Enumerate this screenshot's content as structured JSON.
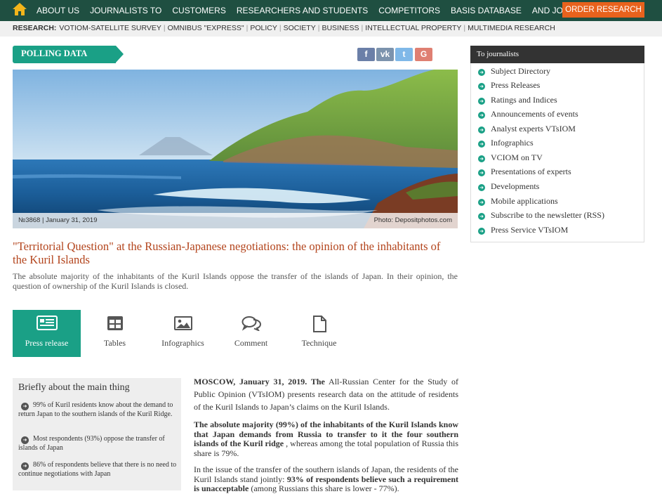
{
  "nav": {
    "items": [
      "ABOUT US",
      "JOURNALISTS TO",
      "CUSTOMERS",
      "RESEARCHERS AND STUDENTS",
      "COMPETITORS",
      "BASIS DATABASE",
      "AND JOURNAL"
    ],
    "order_button": "ORDER RESEARCH",
    "colors": {
      "bar": "#1f4f41",
      "order": "#e8621d"
    }
  },
  "research": {
    "label": "RESEARCH:",
    "items": [
      "VOTIOM-SATELLITE SURVEY",
      "OMNIBUS \"EXPRESS\"",
      "POLICY",
      "SOCIETY",
      "BUSINESS",
      "INTELLECTUAL PROPERTY",
      "MULTIMEDIA RESEARCH"
    ]
  },
  "polling_label": "POLLING DATA",
  "share": {
    "fb": "f",
    "vk": "vk",
    "tw": "t",
    "gp": "G"
  },
  "hero": {
    "id_date": "№3868 | January 31, 2019",
    "photo_credit": "Photo: Depositphotos.com"
  },
  "article": {
    "title": "\"Territorial Question\" at the Russian-Japanese negotiations: the opinion of the inhabitants of the Kuril Islands",
    "lead": "The absolute majority of the inhabitants of the Kuril Islands oppose the transfer of the islands of Japan. In their opinion, the question of ownership of the Kuril Islands is closed.",
    "p1_bold": "MOSCOW, January 31, 2019. The",
    "p1_rest": "All-Russian Center for the Study of Public Opinion (VTsIOM) presents research data on the attitude of residents of the Kuril Islands to Japan’s claims on the Kuril Islands.",
    "p2_bold": "The absolute majority (99%) of the inhabitants of the Kuril Islands know that Japan demands from Russia to transfer to it the four southern islands of the Kuril ridge",
    "p2_rest": ", whereas among the total population of Russia this share is 79%.",
    "p3_start": "In the issue of the transfer of the southern islands of Japan, the residents of the Kuril Islands stand jointly:",
    "p3_bold": "93% of respondents believe such a requirement is unacceptable",
    "p3_rest": "(among Russians this share is lower - 77%)."
  },
  "tabs": [
    {
      "label": "Press release",
      "icon": "newspaper-icon",
      "active": true
    },
    {
      "label": "Tables",
      "icon": "table-icon",
      "active": false
    },
    {
      "label": "Infographics",
      "icon": "image-icon",
      "active": false
    },
    {
      "label": "Comment",
      "icon": "comment-icon",
      "active": false
    },
    {
      "label": "Technique",
      "icon": "document-icon",
      "active": false
    }
  ],
  "brief": {
    "heading": "Briefly about the main thing",
    "items": [
      "99% of Kuril residents know about the demand to return Japan to the southern islands of the Kuril Ridge.",
      "Most respondents (93%) oppose the transfer of islands of Japan",
      "86% of respondents believe that there is no need to continue negotiations with Japan"
    ]
  },
  "sidebar": {
    "heading": "To journalists",
    "items": [
      "Subject Directory",
      "Press Releases",
      "Ratings and Indices",
      "Announcements of events",
      "Analyst experts VTsIOM",
      "Infographics",
      "VCIOM on TV",
      "Presentations of experts",
      "Developments",
      "Mobile applications",
      "Subscribe to the newsletter (RSS)",
      "Press Service VTsIOM"
    ]
  }
}
